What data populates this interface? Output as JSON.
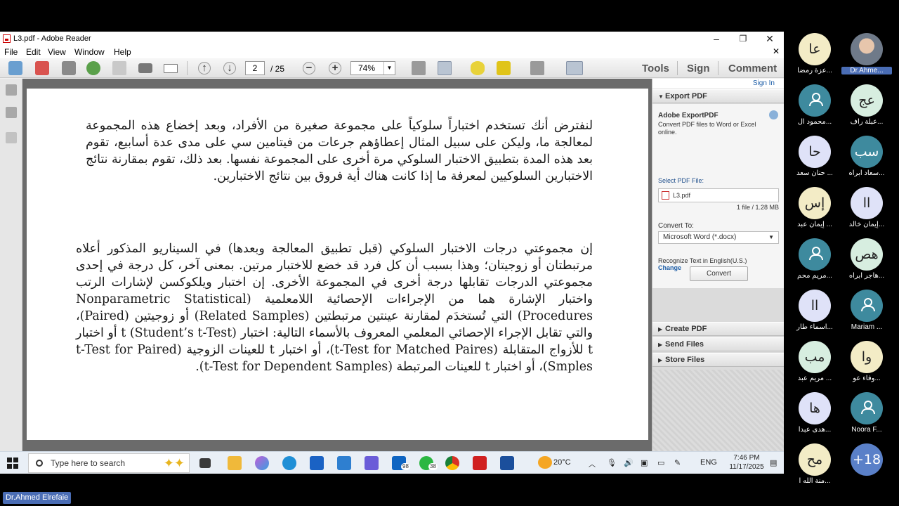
{
  "window": {
    "title": "L3.pdf - Adobe Reader"
  },
  "menu": [
    "File",
    "Edit",
    "View",
    "Window",
    "Help"
  ],
  "toolbar": {
    "current_page": "2",
    "page_total": "/ 25",
    "zoom": "74%",
    "tabs": [
      "Tools",
      "Sign",
      "Comment"
    ]
  },
  "document": {
    "paragraph1": "لنفترض أنك تستخدم اختباراً سلوكياً على مجموعة صغيرة من الأفراد، وبعد إخضاع هذه المجموعة لمعالجة ما، وليكن على سبيل المثال إعطاؤهم جرعات من فيتامين سي على مدى عدة أسابيع، تقوم بعد هذه المدة بتطبيق الاختبار السلوكي مرة أخرى على المجموعة نفسها. بعد ذلك، تقوم بمقارنة نتائج الاختبارين السلوكيين لمعرفة ما إذا كانت هناك أية فروق بين نتائج الاختبارين.",
    "paragraph2": "إن مجموعتي درجات الاختبار السلوكي (قبل تطبيق المعالجة وبعدها) في السيناريو المذكور أعلاه مرتبطتان أو زوجيتان؛ وهذا بسبب أن كل فرد قد خضع للاختبار مرتين. بمعنى آخر، كل درجة في إحدى مجموعتي الدرجات تقابلها درجة أخرى في المجموعة الأخرى. إن اختبار ويلكوكسن لإشارات الرتب واختبار الإشارة هما من الإجراءات الإحصائية اللامعلمية (Nonparametric Statistical Procedures) التي تُستخدَم لمقارنة عينتين مرتبطتين (Related Samples) أو زوجيتين (Paired)، والتي تقابل الإجراء الإحصائي المعلمي المعروف بالأسماء التالية: اختبار t (Student’s t-Test) أو اختبار t للأزواج المتقابلة (t-Test for Matched Paires)، أو اختبار t للعينات الزوجية (t-Test for Paired Smples)، أو اختبار t للعينات المرتبطة (t-Test for Dependent Samples)."
  },
  "panel": {
    "sign_in": "Sign In",
    "export_header": "Export PDF",
    "adobe_export": "Adobe ExportPDF",
    "description": "Convert PDF files to Word or Excel online.",
    "select_label": "Select PDF File:",
    "file_name": "L3.pdf",
    "file_info": "1 file / 1.28 MB",
    "convert_to_label": "Convert To:",
    "convert_to_value": "Microsoft Word (*.docx)",
    "recognize": "Recognize Text in English(U.S.)",
    "change": "Change",
    "convert_button": "Convert",
    "sections": [
      "Create PDF",
      "Send Files",
      "Store Files"
    ]
  },
  "taskbar": {
    "search_placeholder": "Type here to search",
    "badge_outlook": "98",
    "badge_whatsapp": "38",
    "weather": "20°C",
    "language": "ENG",
    "time": "7:46 PM",
    "date": "11/17/2025"
  },
  "participants": [
    {
      "initials": "عا",
      "name": "عزة رمضا...",
      "style": "cr"
    },
    {
      "initials": "",
      "name": "Dr.Ahme...",
      "style": "photo",
      "highlight": true
    },
    {
      "initials": "",
      "name": "محمود ال...",
      "style": "tl"
    },
    {
      "initials": "عج",
      "name": "عبلة راف...",
      "style": "gr"
    },
    {
      "initials": "حا",
      "name": "حنان سعد ...",
      "style": "lv"
    },
    {
      "initials": "سب",
      "name": "سعاد ابراه...",
      "style": "tl"
    },
    {
      "initials": "إس",
      "name": "إيمان عبد ...",
      "style": "cr"
    },
    {
      "initials": "اا",
      "name": "إيمان خالد...",
      "style": "lv"
    },
    {
      "initials": "",
      "name": "مريم محم...",
      "style": "tl"
    },
    {
      "initials": "هص",
      "name": "هاجر ابراه...",
      "style": "gr"
    },
    {
      "initials": "اا",
      "name": "اسماء طار...",
      "style": "lv"
    },
    {
      "initials": "",
      "name": "Mariam ...",
      "style": "tl"
    },
    {
      "initials": "مب",
      "name": "مريم عبد ...",
      "style": "gr"
    },
    {
      "initials": "وا",
      "name": "وفاء عو...",
      "style": "cr"
    },
    {
      "initials": "ها",
      "name": "هدى عبدا...",
      "style": "lv"
    },
    {
      "initials": "",
      "name": "Noora F...",
      "style": "tl"
    },
    {
      "initials": "مح",
      "name": "منة الله ا...",
      "style": "cr"
    },
    {
      "initials": "+18",
      "name": "",
      "style": "bl"
    }
  ],
  "active_speaker": "Dr.Ahmed Elrefaie"
}
